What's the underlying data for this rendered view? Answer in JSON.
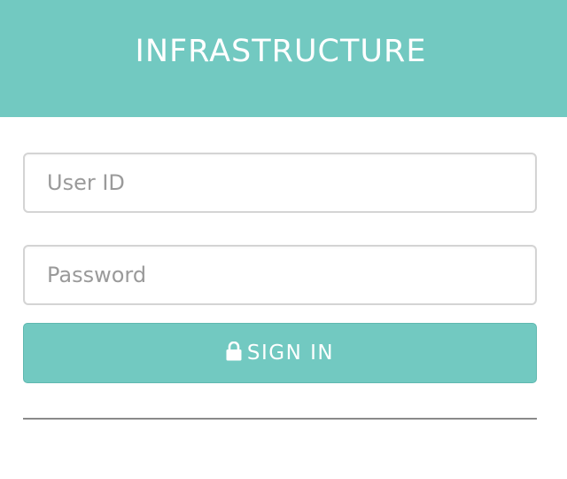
{
  "header": {
    "title": "INFRASTRUCTURE"
  },
  "form": {
    "userid_placeholder": "User ID",
    "userid_value": "",
    "password_placeholder": "Password",
    "password_value": "",
    "signin_label": "SIGN IN",
    "signin_icon": "lock-icon"
  },
  "colors": {
    "accent": "#72c9c1",
    "field_border": "#d4d4d4",
    "divider": "#8a8a8a"
  }
}
